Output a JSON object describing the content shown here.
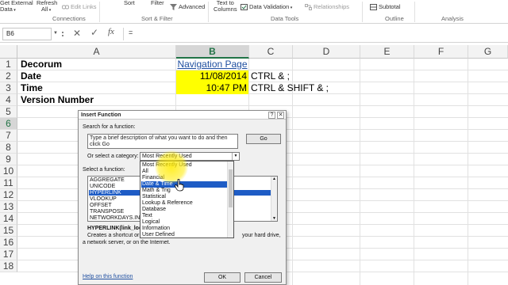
{
  "ribbon": {
    "top_left": "Get External",
    "data_label": "Data",
    "refresh": "Refresh",
    "all": "All",
    "edit_links": "Edit Links",
    "sort": "Sort",
    "filter": "Filter",
    "advanced": "Advanced",
    "text_to": "Text to",
    "columns": "Columns",
    "data_validation": "Data Validation",
    "relationships": "Relationships",
    "subtotal": "Subtotal",
    "groups": {
      "connections": "Connections",
      "sort_filter": "Sort & Filter",
      "data_tools": "Data Tools",
      "outline": "Outline",
      "analysis": "Analysis"
    }
  },
  "formula_bar": {
    "name_box": "B6",
    "fx": "fx",
    "content": "="
  },
  "columns": [
    "A",
    "B",
    "C",
    "D",
    "E",
    "F",
    "G"
  ],
  "rows": [
    "1",
    "2",
    "3",
    "4",
    "5",
    "6",
    "7",
    "8",
    "9",
    "10",
    "11",
    "12",
    "13",
    "14",
    "15",
    "16",
    "17",
    "18"
  ],
  "cells": {
    "a1": "Decorum",
    "b1": "Navigation Page",
    "a2": "Date",
    "b2": "11/08/2014",
    "c2": "CTRL & ;",
    "a3": "Time",
    "b3": "10:47 PM",
    "c3": "CTRL & SHIFT & ;",
    "a4": "Version Number"
  },
  "dialog": {
    "title": "Insert Function",
    "help_btn": "?",
    "close_btn": "✕",
    "search_label": "Search for a function:",
    "search_text": "Type a brief description of what you want to do and then click Go",
    "go_btn": "Go",
    "category_label": "Or select a category:",
    "category_value": "Most Recently Used",
    "function_label": "Select a function:",
    "functions": [
      "AGGREGATE",
      "UNICODE",
      "HYPERLINK",
      "VLOOKUP",
      "OFFSET",
      "TRANSPOSE",
      "NETWORKDAYS.INTL"
    ],
    "selected_function_index": 2,
    "categories": [
      "Most Recently Used",
      "All",
      "Financial",
      "Date & Time",
      "Math & Trig",
      "Statistical",
      "Lookup & Reference",
      "Database",
      "Text",
      "Logical",
      "Information",
      "User Defined"
    ],
    "selected_category_index": 3,
    "signature": "HYPERLINK(link_loc",
    "desc_line1_left": "Creates a shortcut or",
    "desc_line1_right": "your hard drive,",
    "desc_line2": "a network server, or on the Internet.",
    "help_link": "Help on this function",
    "ok_btn": "OK",
    "cancel_btn": "Cancel"
  },
  "colors": {
    "accent": "#217346",
    "selection": "#1e5cc5",
    "cell_highlight": "#ffff00"
  }
}
